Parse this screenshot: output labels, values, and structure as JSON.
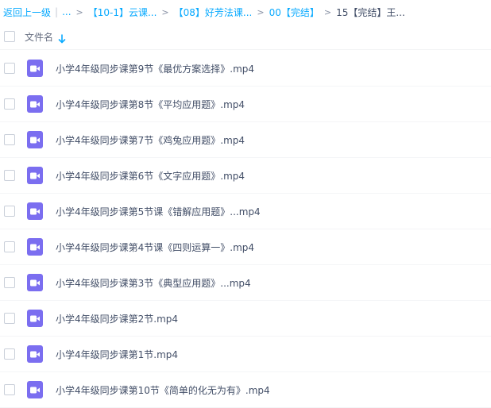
{
  "breadcrumb": {
    "back_label": "返回上一级",
    "divider": "|",
    "ellipsis": "...",
    "crumbs": [
      "【10-1】云课...",
      "【08】好芳法课...",
      "00【完结】"
    ],
    "current": "15【完结】王...",
    "arrow": ">"
  },
  "header": {
    "column_name": "文件名",
    "sort_icon": "arrow-down-icon"
  },
  "files": [
    {
      "name": "小学4年级同步课第9节《最优方案选择》.mp4",
      "icon": "video-file-icon"
    },
    {
      "name": "小学4年级同步课第8节《平均应用题》.mp4",
      "icon": "video-file-icon"
    },
    {
      "name": "小学4年级同步课第7节《鸡兔应用题》.mp4",
      "icon": "video-file-icon"
    },
    {
      "name": "小学4年级同步课第6节《文字应用题》.mp4",
      "icon": "video-file-icon"
    },
    {
      "name": "小学4年级同步课第5节课《错解应用题》...mp4",
      "icon": "video-file-icon"
    },
    {
      "name": "小学4年级同步课第4节课《四则运算一》.mp4",
      "icon": "video-file-icon"
    },
    {
      "name": "小学4年级同步课第3节《典型应用题》...mp4",
      "icon": "video-file-icon"
    },
    {
      "name": "小学4年级同步课第2节.mp4",
      "icon": "video-file-icon"
    },
    {
      "name": "小学4年级同步课第1节.mp4",
      "icon": "video-file-icon"
    },
    {
      "name": "小学4年级同步课第10节《简单的化无为有》.mp4",
      "icon": "video-file-icon"
    }
  ],
  "colors": {
    "link": "#09aaff",
    "video_icon": "#7b6ef0",
    "text": "#424e67"
  }
}
